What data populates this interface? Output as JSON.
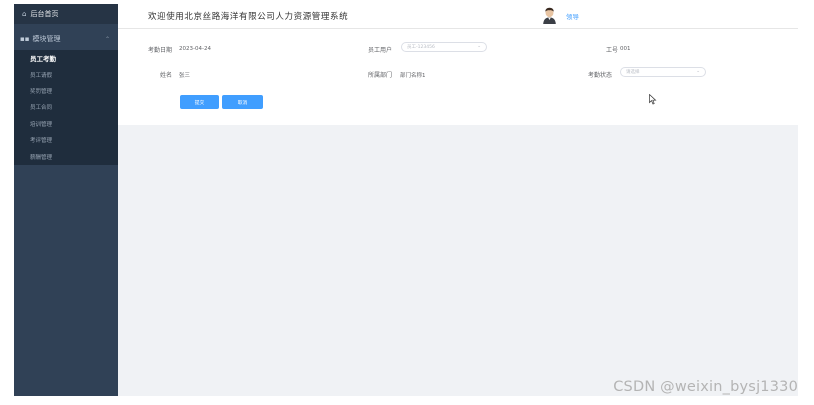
{
  "sidebar": {
    "home_label": "后台首页",
    "group_label": "模块管理",
    "items": [
      {
        "label": "员工考勤",
        "active": true
      },
      {
        "label": "员工请假"
      },
      {
        "label": "奖罚管理"
      },
      {
        "label": "员工合同"
      },
      {
        "label": "培训管理"
      },
      {
        "label": "考评管理"
      },
      {
        "label": "薪酬管理"
      }
    ]
  },
  "header": {
    "welcome": "欢迎使用北京丝路海洋有限公司人力资源管理系统",
    "username": "领导"
  },
  "form": {
    "date_label": "考勤日期",
    "date_value": "2023-04-24",
    "user_label": "员工用户",
    "user_value": "员工-123456",
    "job_label": "工号",
    "job_value": "001",
    "name_label": "姓名",
    "name_value": "张三",
    "dept_label": "所属部门",
    "dept_value": "部门名称1",
    "status_label": "考勤状态",
    "status_placeholder": "请选择",
    "submit_label": "提交",
    "cancel_label": "取消"
  },
  "watermark": "CSDN @weixin_bysj1330",
  "colors": {
    "sidebar_bg": "#304156",
    "primary": "#409eff",
    "content_bg": "#f0f2f5"
  }
}
